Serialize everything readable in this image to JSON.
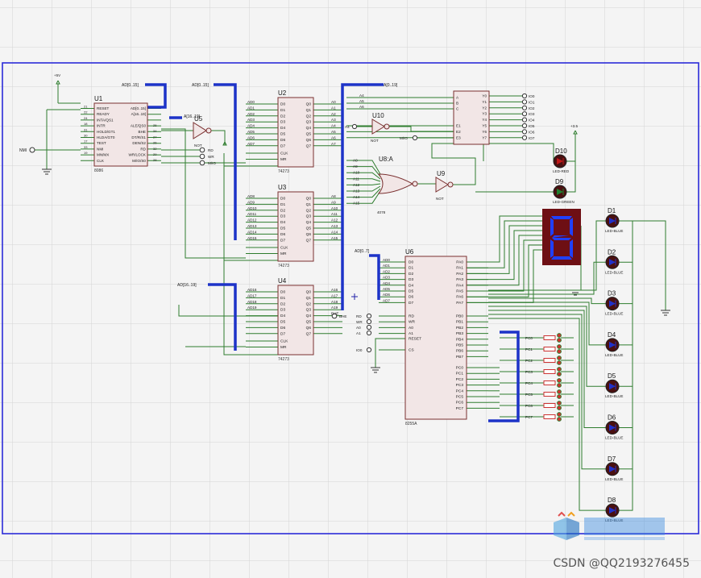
{
  "sheet": {
    "border_color": "#2b2bd8",
    "grid_color": "#d6d6d6",
    "wire_color": "#2e7d2e",
    "bus_color": "#1d33c8",
    "chip_fill": "#f2e6e6",
    "chip_stroke": "#7a3030"
  },
  "chips": {
    "u1": {
      "ref": "U1",
      "part": "8086",
      "pins_left": [
        "RESET",
        "READY",
        "INTA/QS1",
        "INTR",
        "HOLD/GT1",
        "HLDA/GT0",
        "TEST",
        "NMI",
        "MN/MX",
        "CLK"
      ],
      "pins_left_nums": [
        "21",
        "22",
        "24",
        "18",
        "31",
        "30",
        "17",
        "33",
        "19"
      ],
      "pins_right": [
        "AD[0..15]",
        "A[16..19]",
        "",
        "ALE/QS0",
        "BHE",
        "DT/R/S1",
        "DEN/S2",
        "RD",
        "WR/LOCK",
        "M/IO/S0"
      ],
      "pins_right_nums": [
        "25",
        "34",
        "27",
        "26",
        "32",
        "29",
        "28"
      ]
    },
    "u2": {
      "ref": "U2",
      "part": "74273",
      "in": [
        "D0",
        "D1",
        "D2",
        "D3",
        "D4",
        "D5",
        "D6",
        "D7",
        "CLK",
        "MR"
      ],
      "out": [
        "Q0",
        "Q1",
        "Q2",
        "Q3",
        "Q4",
        "Q5",
        "Q6",
        "Q7"
      ],
      "in_nets": [
        "AD0",
        "AD1",
        "AD2",
        "AD3",
        "AD4",
        "AD5",
        "AD6",
        "AD7"
      ],
      "out_nets": [
        "A0",
        "A1",
        "A2",
        "A3",
        "A4",
        "A5",
        "A6",
        "A7"
      ]
    },
    "u3": {
      "ref": "U3",
      "part": "74273",
      "in": [
        "D0",
        "D1",
        "D2",
        "D3",
        "D4",
        "D5",
        "D6",
        "D7",
        "CLK",
        "MR"
      ],
      "out": [
        "Q0",
        "Q1",
        "Q2",
        "Q3",
        "Q4",
        "Q5",
        "Q6",
        "Q7"
      ],
      "in_nets": [
        "AD8",
        "AD9",
        "AD10",
        "AD11",
        "AD12",
        "AD13",
        "AD14",
        "AD15"
      ],
      "out_nets": [
        "A8",
        "A9",
        "A10",
        "A11",
        "A12",
        "A13",
        "A14",
        "A15"
      ]
    },
    "u4": {
      "ref": "U4",
      "part": "74273",
      "in": [
        "D0",
        "D1",
        "D2",
        "D3",
        "D4",
        "D5",
        "D6",
        "D7",
        "CLK",
        "MR"
      ],
      "out": [
        "Q0",
        "Q1",
        "Q2",
        "Q3",
        "Q4",
        "Q5",
        "Q6",
        "Q7"
      ],
      "in_nets": [
        "AD16",
        "AD17",
        "AD18",
        "AD19"
      ],
      "out_nets": [
        "A16",
        "A17",
        "A18",
        "A19",
        "BHE"
      ]
    },
    "u5": {
      "ref": "U5",
      "part": "NOT"
    },
    "u6": {
      "ref": "U6",
      "part": "8255A",
      "in": [
        "D0",
        "D1",
        "D2",
        "D3",
        "D4",
        "D5",
        "D6",
        "D7",
        "RD",
        "WR",
        "A0",
        "A1",
        "RESET",
        "CS"
      ],
      "in_nets": [
        "AD0",
        "AD1",
        "AD2",
        "AD3",
        "AD4",
        "AD5",
        "AD6",
        "AD7"
      ],
      "out": [
        "PA0",
        "PA1",
        "PA2",
        "PA3",
        "PA4",
        "PA5",
        "PA6",
        "PA7",
        "PB0",
        "PB1",
        "PB2",
        "PB3",
        "PB4",
        "PB5",
        "PB6",
        "PB7",
        "PC0",
        "PC1",
        "PC2",
        "PC3",
        "PC4",
        "PC5",
        "PC6",
        "PC7"
      ]
    },
    "u7": {
      "ref": "",
      "part": "",
      "in": [
        "A",
        "B",
        "C",
        "E1",
        "E2",
        "E3"
      ],
      "out": [
        "Y0",
        "Y1",
        "Y2",
        "Y3",
        "Y4",
        "Y5",
        "Y6",
        "Y7"
      ],
      "in_nets": [
        "A4",
        "A5",
        "A6"
      ]
    },
    "u8": {
      "ref": "U8:A",
      "part": "4078",
      "in_nets": [
        "A8",
        "A9",
        "A10",
        "A11",
        "A12",
        "A13",
        "A14",
        "A15"
      ]
    },
    "u9": {
      "ref": "U9",
      "part": "NOT"
    },
    "u10": {
      "ref": "U10",
      "part": "NOT"
    }
  },
  "bus_labels": {
    "ad_0_15": "AD[0..15]",
    "ad_0_15b": "AD[0..15]",
    "a_0_19": "A[0..19]",
    "a_16_19": "A[16..19]",
    "ad_16_19": "AD[16..19]",
    "ad_0_7": "AD[0..7]"
  },
  "nets": {
    "nmi": "NMI",
    "rd": "RD",
    "wr": "WR",
    "mio": "M/IO",
    "bhe": "BHE",
    "a0": "A0",
    "a1": "A1",
    "io0": "IO0",
    "a4": "A4",
    "mio2": "M/IO",
    "v5": "+5V",
    "v35": "+3.5"
  },
  "io_labels": [
    "IO0",
    "IO1",
    "IO2",
    "IO3",
    "IO4",
    "IO5",
    "IO6",
    "IO7"
  ],
  "pc_labels": [
    "PC0",
    "PC1",
    "PC2",
    "PC3",
    "PC4",
    "PC5",
    "PC6",
    "PC7"
  ],
  "leds": {
    "d10": {
      "ref": "D10",
      "type": "LED-RED",
      "color": "#c01818"
    },
    "d9": {
      "ref": "D9",
      "type": "LED-GREEN",
      "color": "#208030"
    },
    "blue": [
      {
        "ref": "D1",
        "type": "LED-BLUE"
      },
      {
        "ref": "D2",
        "type": "LED-BLUE"
      },
      {
        "ref": "D3",
        "type": "LED-BLUE"
      },
      {
        "ref": "D4",
        "type": "LED-BLUE"
      },
      {
        "ref": "D5",
        "type": "LED-BLUE"
      },
      {
        "ref": "D6",
        "type": "LED-BLUE"
      },
      {
        "ref": "D7",
        "type": "LED-BLUE"
      },
      {
        "ref": "D8",
        "type": "LED-BLUE"
      }
    ],
    "blue_color": "#2030c8"
  },
  "seven_segment": {
    "digit": "8",
    "bg": "#6e0f14",
    "segment_color": "#2040ff"
  },
  "watermark": {
    "text": "CSDN @QQ2193276455"
  }
}
